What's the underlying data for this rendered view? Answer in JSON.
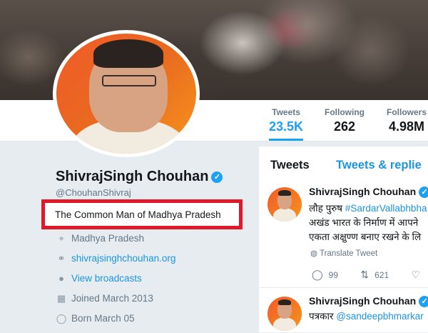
{
  "stats": [
    {
      "label": "Tweets",
      "value": "23.5K"
    },
    {
      "label": "Following",
      "value": "262"
    },
    {
      "label": "Followers",
      "value": "4.98M"
    }
  ],
  "profile": {
    "name": "ShivrajSingh Chouhan",
    "handle": "@ChouhanShivraj",
    "bio": "The Common Man of Madhya Pradesh",
    "location": "Madhya Pradesh",
    "website": "shivrajsinghchouhan.org",
    "broadcasts": "View broadcasts",
    "joined": "Joined March 2013",
    "born": "Born March 05"
  },
  "timeline": {
    "tabs": [
      "Tweets",
      "Tweets & replie"
    ],
    "tweets": [
      {
        "author": "ShivrajSingh Chouhan",
        "line1_prefix": "लौह पुरुष ",
        "line1_link": "#SardarVallabhbha",
        "line2": "अखंड भारत के निर्माण में आपने",
        "line3": "एकता अक्षुण्ण बनाए रखने के लि",
        "translate": "Translate Tweet",
        "replies": "99",
        "retweets": "621"
      },
      {
        "author": "ShivrajSingh Chouhan",
        "line1_prefix": "पत्रकार ",
        "line1_link": "@sandeepbhmarkar"
      }
    ]
  },
  "colors": {
    "accent": "#1da1f2",
    "link": "#1b95e0",
    "highlight_box": "#e0192a",
    "avatar_bg": "#f15a29"
  }
}
